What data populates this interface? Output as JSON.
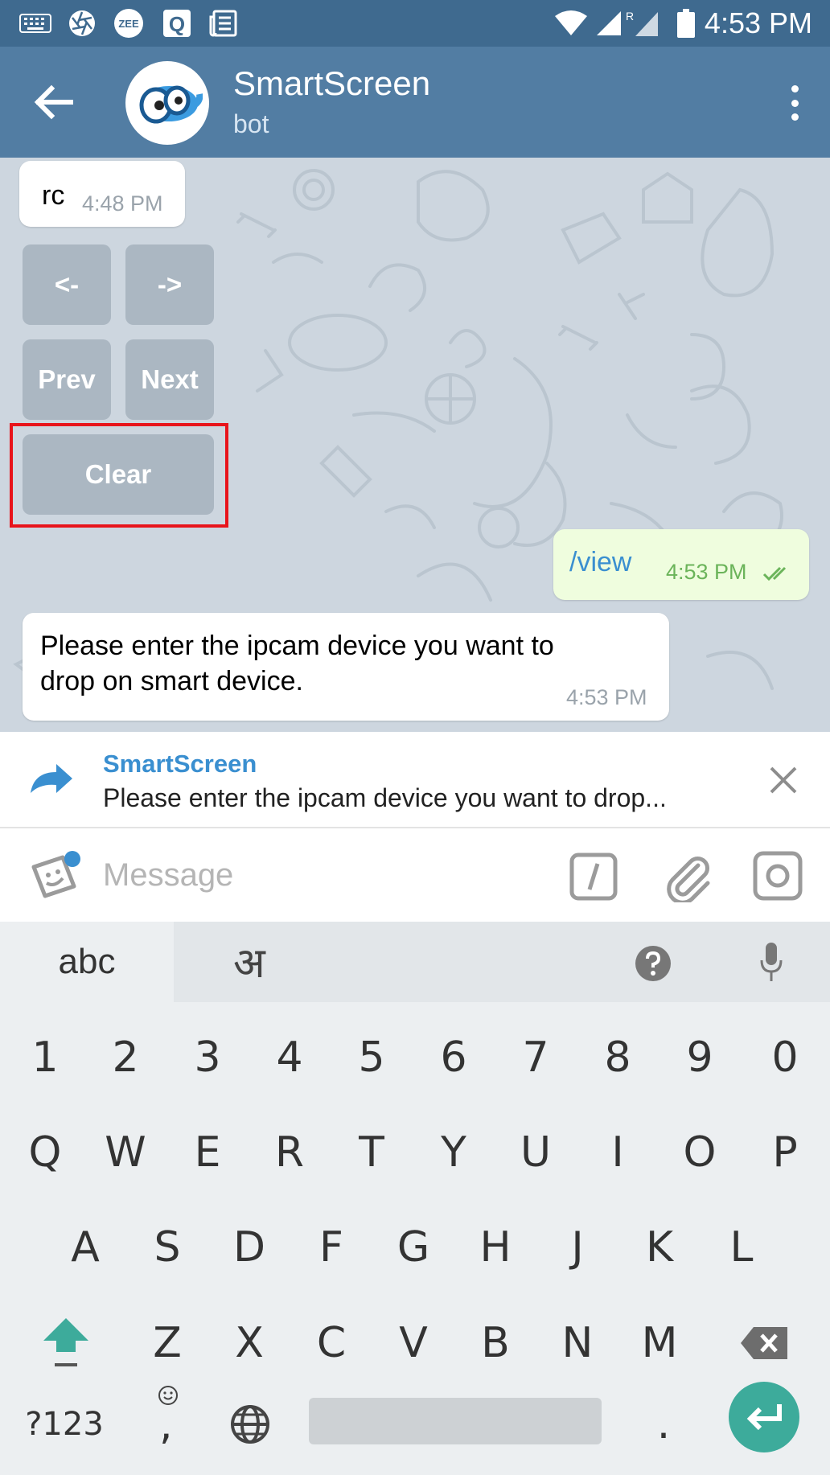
{
  "status_bar": {
    "time": "4:53 PM",
    "icons": [
      "keyboard-icon",
      "camera-aperture-icon",
      "zee-app-icon",
      "q-app-icon",
      "news-icon",
      "wifi-icon",
      "signal-icon",
      "roaming-signal-icon",
      "battery-icon"
    ],
    "zee_label": "ZEE",
    "q_label": "Q",
    "roaming_label": "R"
  },
  "header": {
    "title": "SmartScreen",
    "subtitle": "bot",
    "back_icon": "arrow-left-icon",
    "menu_icon": "more-vertical-icon"
  },
  "chat": {
    "messages": [
      {
        "direction": "in",
        "text": "rc",
        "time": "4:48 PM"
      },
      {
        "direction": "out",
        "text": "/view",
        "time": "4:53 PM",
        "read": true
      },
      {
        "direction": "in",
        "text_line1": "Please enter the ipcam device you want to",
        "text_line2": "drop on smart device.",
        "time": "4:53 PM"
      }
    ],
    "keyboard_buttons": [
      {
        "label": "<-"
      },
      {
        "label": "->"
      },
      {
        "label": "Prev"
      },
      {
        "label": "Next"
      },
      {
        "label": "Clear"
      }
    ],
    "highlight_color": "#e8141b"
  },
  "reply_bar": {
    "name": "SmartScreen",
    "text": "Please enter the ipcam device you want to drop...",
    "icon": "forward-arrow-icon",
    "close_icon": "close-icon"
  },
  "input_bar": {
    "placeholder": "Message",
    "icons": [
      "sticker-icon",
      "slash-command-icon",
      "paperclip-icon",
      "camera-icon"
    ]
  },
  "keyboard": {
    "mode_tab": "abc",
    "hindi_tab": "अ",
    "number_row": [
      "1",
      "2",
      "3",
      "4",
      "5",
      "6",
      "7",
      "8",
      "9",
      "0"
    ],
    "row1": [
      "Q",
      "W",
      "E",
      "R",
      "T",
      "Y",
      "U",
      "I",
      "O",
      "P"
    ],
    "row2": [
      "A",
      "S",
      "D",
      "F",
      "G",
      "H",
      "J",
      "K",
      "L"
    ],
    "row3": [
      "Z",
      "X",
      "C",
      "V",
      "B",
      "N",
      "M"
    ],
    "symbols_key": "?123",
    "comma_key": ",",
    "period_key": ".",
    "colors": {
      "enter_key": "#3dab9b",
      "shift_key": "#3dab9b"
    }
  },
  "colors": {
    "header": "#527da3",
    "status_bar": "#3f6a8f",
    "outgoing_bubble": "#effdde",
    "link_blue": "#3a8fd0"
  }
}
